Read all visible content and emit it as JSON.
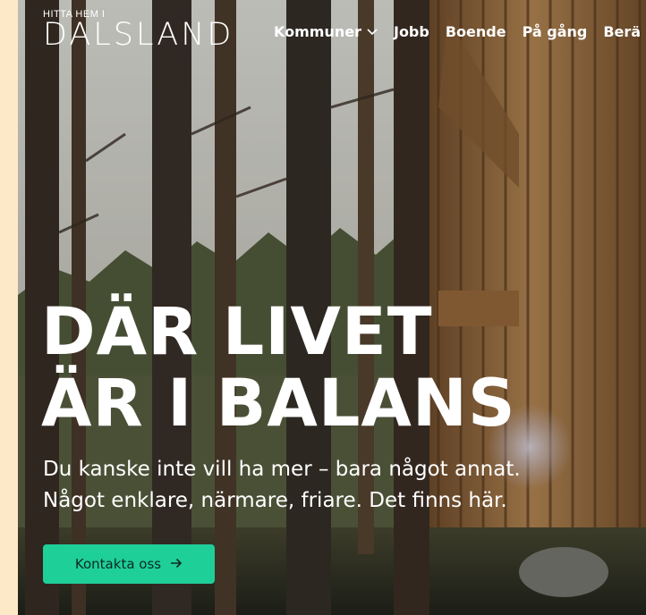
{
  "logo": {
    "small": "HITTA HEM I",
    "main": "DALSLAND"
  },
  "nav": {
    "items": [
      {
        "label": "Kommuner",
        "icon": "chevron-down-icon"
      },
      {
        "label": "Jobb"
      },
      {
        "label": "Boende"
      },
      {
        "label": "På gång"
      },
      {
        "label": "Berä"
      }
    ]
  },
  "hero": {
    "headline_line1": "DÄR LIVET",
    "headline_line2": "ÄR I BALANS",
    "sub_line1": "Du kanske inte vill ha mer – bara något annat.",
    "sub_line2": "Något enklare, närmare, friare. Det finns här.",
    "cta_label": "Kontakta oss",
    "cta_icon": "arrow-right-icon"
  },
  "colors": {
    "page_bg": "#fde9c8",
    "cta_bg": "#1fcf98",
    "text": "#ffffff"
  }
}
